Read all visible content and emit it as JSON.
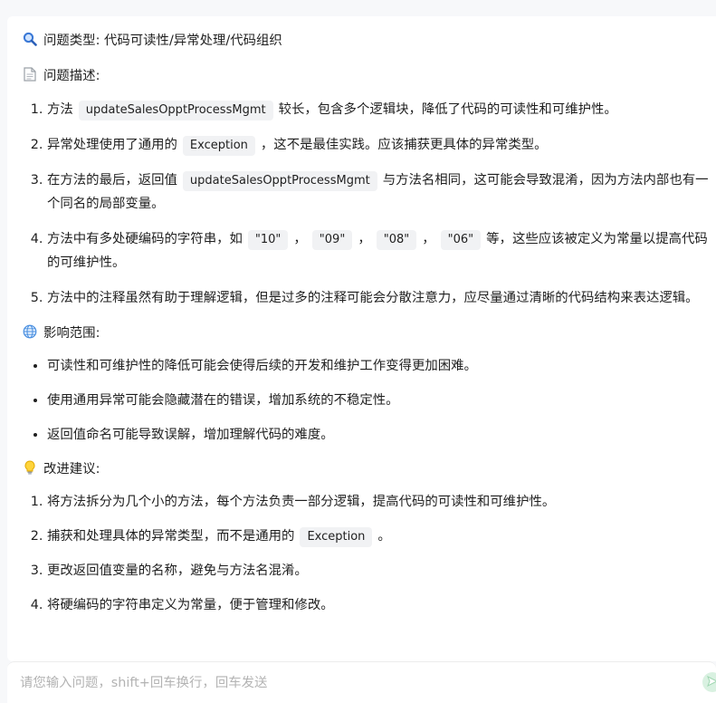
{
  "colors": {
    "page_bg": "#f7f8fa",
    "card_bg": "#ffffff",
    "code_bg": "#f1f2f4",
    "send_button": "#d9f1e1",
    "placeholder": "#b3b3b3"
  },
  "icons": {
    "title": "magnifier-icon",
    "description": "document-icon",
    "impact": "globe-icon",
    "suggestions": "lightbulb-icon",
    "send": "send-icon"
  },
  "title_heading": "问题类型: 代码可读性/异常处理/代码组织",
  "description": {
    "heading": "问题描述:",
    "items": [
      {
        "a": "方法",
        "code": "updateSalesOpptProcessMgmt",
        "b": "较长，包含多个逻辑块，降低了代码的可读性和可维护性。"
      },
      {
        "a": "异常处理使用了通用的",
        "code": "Exception",
        "b": "，这不是最佳实践。应该捕获更具体的异常类型。"
      },
      {
        "a": "在方法的最后，返回值",
        "code": "updateSalesOpptProcessMgmt",
        "b": "与方法名相同，这可能会导致混淆，因为方法内部也有一个同名的局部变量。"
      },
      {
        "a": "方法中有多处硬编码的字符串，如",
        "c1": "\"10\"",
        "s1": "，",
        "c2": "\"09\"",
        "s2": "，",
        "c3": "\"08\"",
        "s3": "，",
        "c4": "\"06\"",
        "b": "等，这些应该被定义为常量以提高代码的可维护性。"
      },
      {
        "text": "方法中的注释虽然有助于理解逻辑，但是过多的注释可能会分散注意力，应尽量通过清晰的代码结构来表达逻辑。"
      }
    ]
  },
  "impact": {
    "heading": "影响范围:",
    "items": [
      "可读性和可维护性的降低可能会使得后续的开发和维护工作变得更加困难。",
      "使用通用异常可能会隐藏潜在的错误，增加系统的不稳定性。",
      "返回值命名可能导致误解，增加理解代码的难度。"
    ]
  },
  "suggestions": {
    "heading": "改进建议:",
    "items": [
      {
        "text": "将方法拆分为几个小的方法，每个方法负责一部分逻辑，提高代码的可读性和可维护性。"
      },
      {
        "a": "捕获和处理具体的异常类型，而不是通用的",
        "code": "Exception",
        "b": "。"
      },
      {
        "text": "更改返回值变量的名称，避免与方法名混淆。"
      },
      {
        "text": "将硬编码的字符串定义为常量，便于管理和修改。"
      }
    ]
  },
  "input": {
    "placeholder": "请您输入问题，shift+回车换行，回车发送",
    "value": ""
  }
}
